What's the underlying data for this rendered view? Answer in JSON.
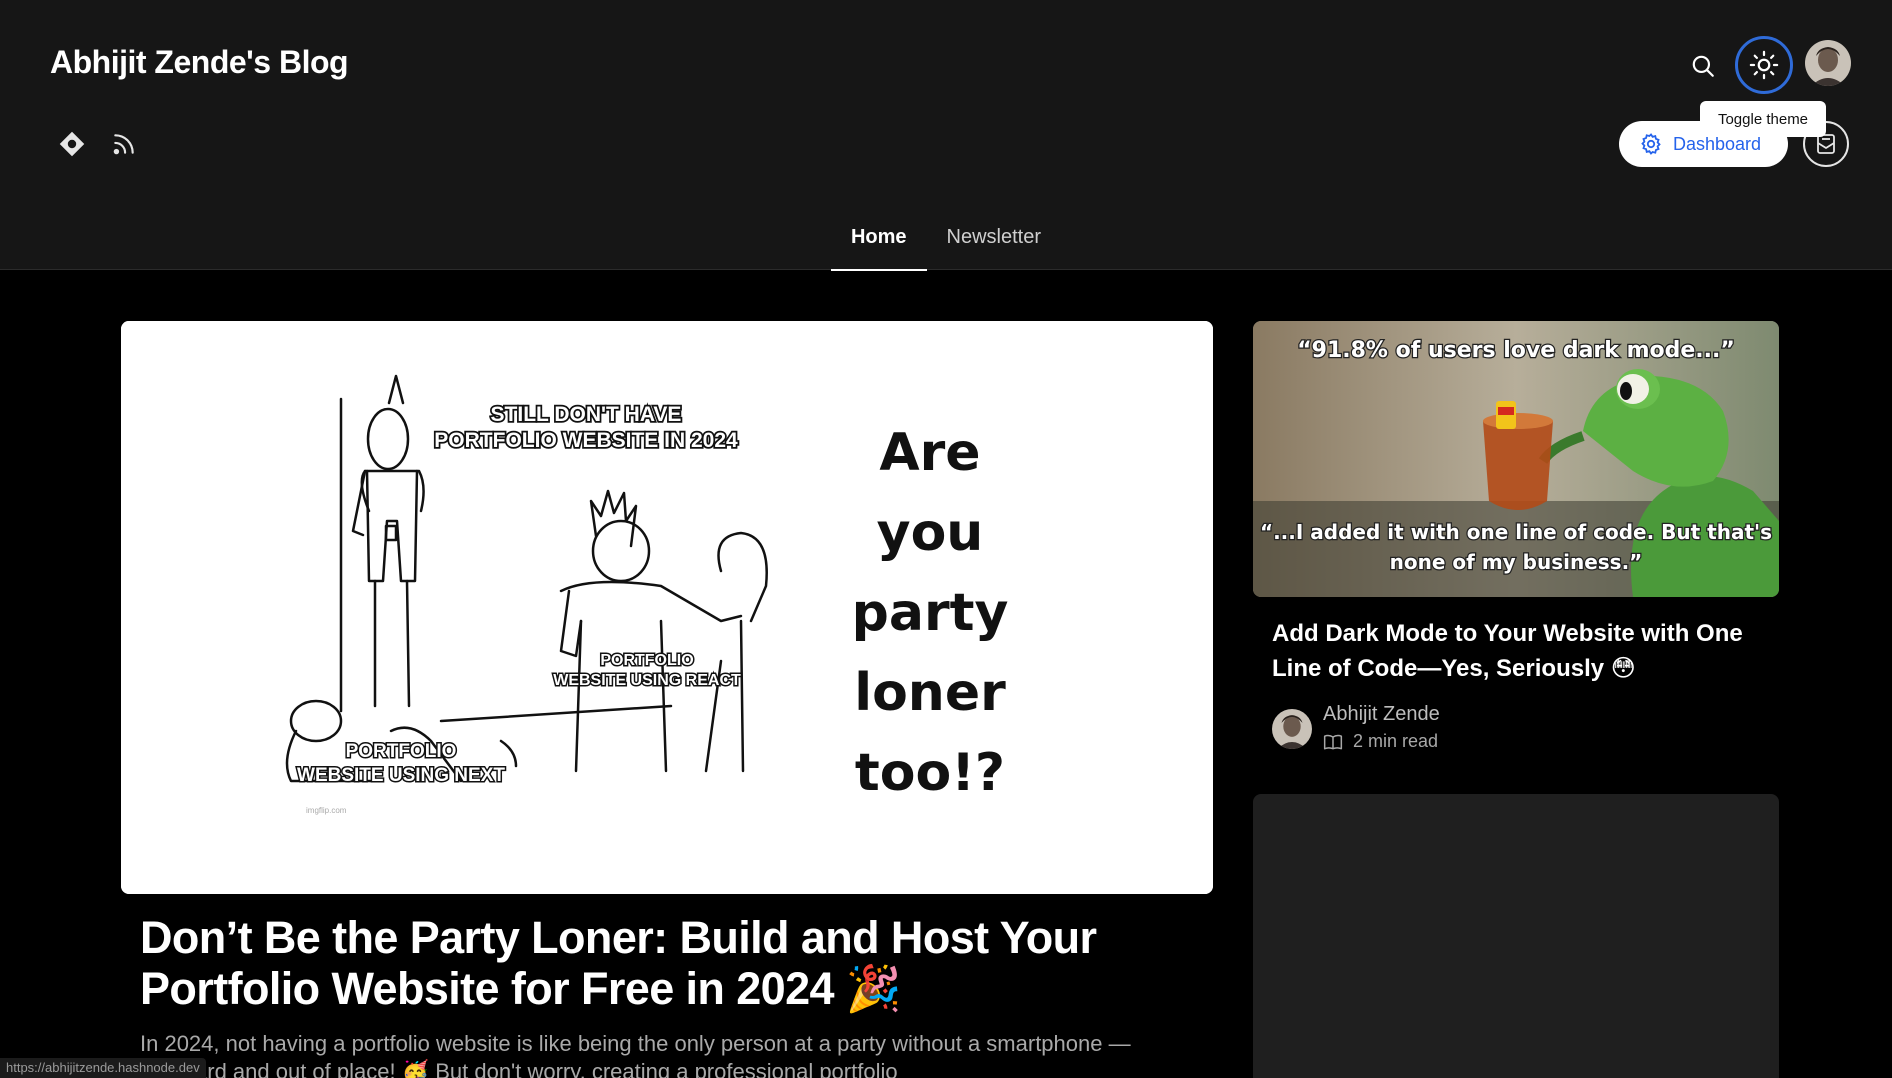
{
  "header": {
    "blog_title": "Abhijit Zende's Blog",
    "toggle_tooltip": "Toggle theme",
    "dashboard_label": "Dashboard"
  },
  "nav": {
    "tabs": [
      {
        "label": "Home",
        "active": true
      },
      {
        "label": "Newsletter",
        "active": false
      }
    ]
  },
  "featured": {
    "meme_caption_1": "STILL DON'T HAVE PORTFOLIO WEBSITE IN 2024",
    "meme_caption_2": "PORTFOLIO WEBSITE USING REACT",
    "meme_caption_3": "PORTFOLIO WEBSITE USING NEXT",
    "meme_watermark": "imgflip.com",
    "meme_side_text": "Are you party loner too!?",
    "title": "Don’t Be the Party Loner: Build and Host Your Portfolio Website for Free in 2024 🎉",
    "excerpt": "In 2024, not having a portfolio website is like being the only person at a party without a smartphone — awkward and out of place! 🥳 But don't worry, creating a professional portfolio"
  },
  "side_post": {
    "img_top_text": "“91.8% of users love dark mode...”",
    "img_bottom_text": "“...I added it with one line of code. But that's none of my business.”",
    "title": "Add Dark Mode to Your Website with One Line of Code—Yes, Seriously 😳",
    "author": "Abhijit Zende",
    "read_time": "2 min read"
  },
  "status_bar": {
    "url": "https://abhijitzende.hashnode.dev"
  },
  "colors": {
    "header_bg": "#161616",
    "page_bg": "#000000",
    "accent": "#2563eb"
  }
}
